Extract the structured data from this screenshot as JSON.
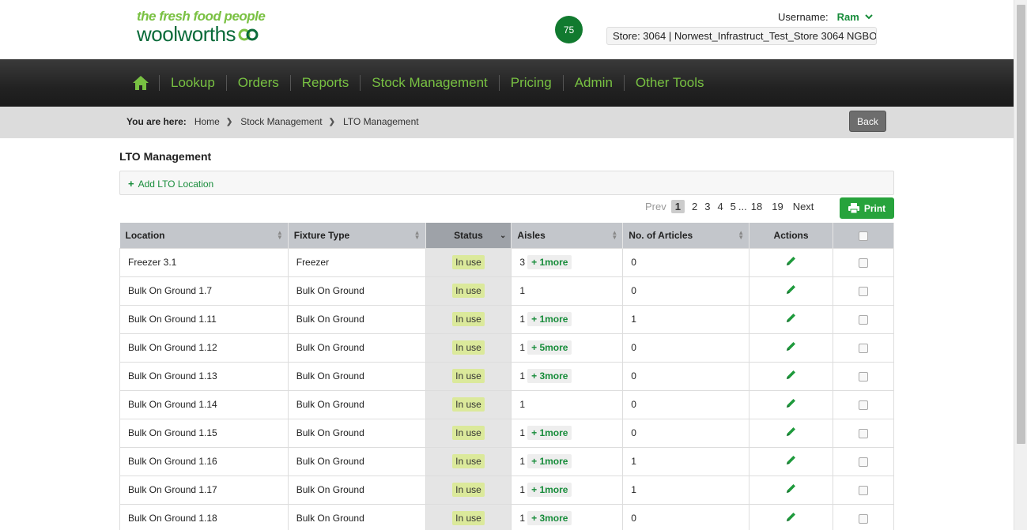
{
  "header": {
    "logo_tagline": "the fresh food people",
    "logo_brand": "woolworths",
    "notification_count": "75",
    "username_label": "Username:",
    "username": "Ram",
    "store": "Store: 3064 | Norwest_Infrastruct_Test_Store 3064 NGBO"
  },
  "nav": {
    "items": [
      "Lookup",
      "Orders",
      "Reports",
      "Stock Management",
      "Pricing",
      "Admin",
      "Other Tools"
    ]
  },
  "breadcrumb": {
    "label": "You are here:",
    "items": [
      "Home",
      "Stock Management",
      "LTO Management"
    ],
    "back_label": "Back"
  },
  "page": {
    "title": "LTO Management",
    "add_label": "Add LTO Location",
    "print_label": "Print"
  },
  "pagination": {
    "prev": "Prev",
    "pages": [
      "1",
      "2",
      "3",
      "4",
      "5"
    ],
    "ellipsis": "...",
    "last_pages": [
      "18",
      "19"
    ],
    "next": "Next",
    "current": "1"
  },
  "table": {
    "headers": [
      "Location",
      "Fixture Type",
      "Status",
      "Aisles",
      "No. of Articles",
      "Actions"
    ],
    "rows": [
      {
        "location": "Freezer 3.1",
        "fixture": "Freezer",
        "status": "In use",
        "aisle": "3",
        "more": "+ 1more",
        "articles": "0"
      },
      {
        "location": "Bulk On Ground 1.7",
        "fixture": "Bulk On Ground",
        "status": "In use",
        "aisle": "1",
        "more": "",
        "articles": "0"
      },
      {
        "location": "Bulk On Ground 1.11",
        "fixture": "Bulk On Ground",
        "status": "In use",
        "aisle": "1",
        "more": "+ 1more",
        "articles": "1"
      },
      {
        "location": "Bulk On Ground 1.12",
        "fixture": "Bulk On Ground",
        "status": "In use",
        "aisle": "1",
        "more": "+ 5more",
        "articles": "0"
      },
      {
        "location": "Bulk On Ground 1.13",
        "fixture": "Bulk On Ground",
        "status": "In use",
        "aisle": "1",
        "more": "+ 3more",
        "articles": "0"
      },
      {
        "location": "Bulk On Ground 1.14",
        "fixture": "Bulk On Ground",
        "status": "In use",
        "aisle": "1",
        "more": "",
        "articles": "0"
      },
      {
        "location": "Bulk On Ground 1.15",
        "fixture": "Bulk On Ground",
        "status": "In use",
        "aisle": "1",
        "more": "+ 1more",
        "articles": "0"
      },
      {
        "location": "Bulk On Ground 1.16",
        "fixture": "Bulk On Ground",
        "status": "In use",
        "aisle": "1",
        "more": "+ 1more",
        "articles": "1"
      },
      {
        "location": "Bulk On Ground 1.17",
        "fixture": "Bulk On Ground",
        "status": "In use",
        "aisle": "1",
        "more": "+ 1more",
        "articles": "1"
      },
      {
        "location": "Bulk On Ground 1.18",
        "fixture": "Bulk On Ground",
        "status": "In use",
        "aisle": "1",
        "more": "+ 3more",
        "articles": "0"
      }
    ]
  },
  "colors": {
    "brand_green": "#178c3a",
    "nav_green": "#78c142",
    "status_bg": "#dbe99b",
    "print_green": "#27a33c"
  },
  "icons": {
    "home": "home-icon",
    "edit": "pencil-icon",
    "print": "printer-icon",
    "sort": "sort-icon"
  }
}
